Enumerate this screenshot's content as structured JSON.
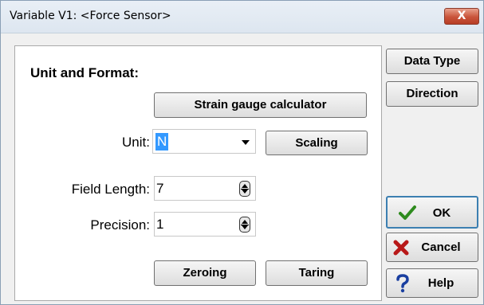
{
  "window": {
    "title": "Variable V1: <Force Sensor>",
    "close_glyph": "X"
  },
  "panel": {
    "heading": "Unit and Format:",
    "strain_gauge_button": "Strain gauge calculator",
    "unit_label": "Unit:",
    "unit_value": "N",
    "scaling_button": "Scaling",
    "field_length_label": "Field Length:",
    "field_length_value": "7",
    "precision_label": "Precision:",
    "precision_value": "1",
    "zeroing_button": "Zeroing",
    "taring_button": "Taring"
  },
  "side": {
    "data_type_button": "Data Type",
    "direction_button": "Direction",
    "ok_button": "OK",
    "cancel_button": "Cancel",
    "help_button": "Help"
  },
  "icons": {
    "ok": "checkmark-icon",
    "cancel": "x-icon",
    "help": "question-icon"
  },
  "colors": {
    "selection": "#3399ff",
    "ok_green": "#2e8b1e",
    "cancel_red": "#b81818",
    "help_blue": "#1a3fa0"
  }
}
